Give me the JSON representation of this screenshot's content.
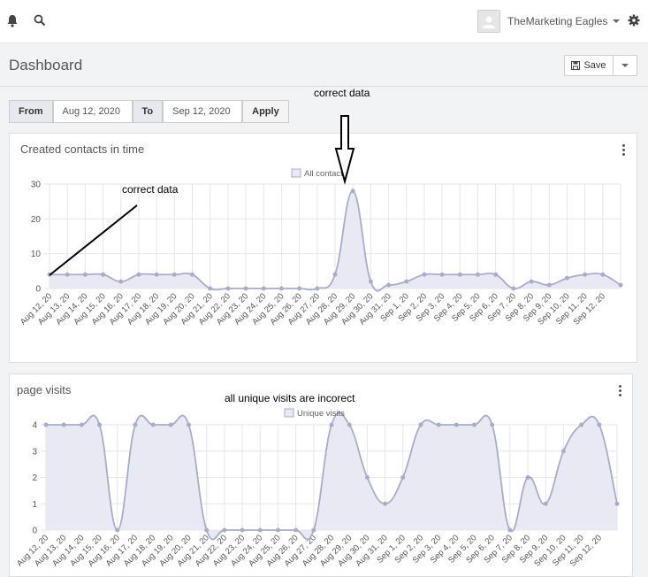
{
  "header": {
    "user_name": "TheMarketing Eagles",
    "icons": [
      "bell-icon",
      "search-icon",
      "user-avatar-icon",
      "chevron-down-icon",
      "gear-icon"
    ]
  },
  "page": {
    "title": "Dashboard",
    "save_label": "Save"
  },
  "filter": {
    "from_label": "From",
    "from_value": "Aug 12, 2020",
    "to_label": "To",
    "to_value": "Sep 12, 2020",
    "apply_label": "Apply"
  },
  "annotations": {
    "top": "correct data",
    "left": "correct data",
    "bottom": "all unique visits are incorect"
  },
  "colors": {
    "series_line": "#a9acc9",
    "series_fill": "#e8e9f3",
    "grid": "#e6e6e6",
    "annotation": "#000000"
  },
  "chart_data": [
    {
      "type": "area",
      "title": "Created contacts in time",
      "series": [
        {
          "name": "All contacts",
          "values": [
            4,
            4,
            4,
            4,
            2,
            4,
            4,
            4,
            4,
            0,
            0,
            0,
            0,
            0,
            0,
            0,
            4,
            28,
            2,
            1,
            2,
            4,
            4,
            4,
            4,
            4,
            0,
            2,
            1,
            3,
            4,
            4,
            1
          ]
        }
      ],
      "x": [
        "Aug 12, 20",
        "Aug 13, 20",
        "Aug 14, 20",
        "Aug 15, 20",
        "Aug 16, 20",
        "Aug 17, 20",
        "Aug 18, 20",
        "Aug 19, 20",
        "Aug 20, 20",
        "Aug 21, 20",
        "Aug 22, 20",
        "Aug 23, 20",
        "Aug 24, 20",
        "Aug 25, 20",
        "Aug 26, 20",
        "Aug 27, 20",
        "Aug 28, 20",
        "Aug 29, 20",
        "Aug 30, 20",
        "Aug 31, 20",
        "Sep 1, 20",
        "Sep 2, 20",
        "Sep 3, 20",
        "Sep 4, 20",
        "Sep 5, 20",
        "Sep 6, 20",
        "Sep 7, 20",
        "Sep 8, 20",
        "Sep 9, 20",
        "Sep 10, 20",
        "Sep 11, 20",
        "Sep 12, 20"
      ],
      "y_ticks": [
        0,
        10,
        20,
        30
      ],
      "ylim": [
        0,
        30
      ],
      "grid": true,
      "legend": "top"
    },
    {
      "type": "area",
      "title": "page visits",
      "series": [
        {
          "name": "Unique visits",
          "values": [
            4,
            4,
            4,
            4,
            0,
            4,
            4,
            4,
            4,
            0,
            0,
            0,
            0,
            0,
            0,
            0,
            4,
            4,
            2,
            1,
            2,
            4,
            4,
            4,
            4,
            4,
            0,
            2,
            1,
            3,
            4,
            4,
            1
          ]
        }
      ],
      "x": [
        "Aug 12, 20",
        "Aug 13, 20",
        "Aug 14, 20",
        "Aug 15, 20",
        "Aug 16, 20",
        "Aug 17, 20",
        "Aug 18, 20",
        "Aug 19, 20",
        "Aug 20, 20",
        "Aug 21, 20",
        "Aug 22, 20",
        "Aug 23, 20",
        "Aug 24, 20",
        "Aug 25, 20",
        "Aug 26, 20",
        "Aug 27, 20",
        "Aug 28, 20",
        "Aug 29, 20",
        "Aug 30, 20",
        "Aug 31, 20",
        "Sep 1, 20",
        "Sep 2, 20",
        "Sep 3, 20",
        "Sep 4, 20",
        "Sep 5, 20",
        "Sep 6, 20",
        "Sep 7, 20",
        "Sep 8, 20",
        "Sep 9, 20",
        "Sep 10, 20",
        "Sep 11, 20",
        "Sep 12, 20"
      ],
      "y_ticks": [
        0,
        1,
        2,
        3,
        4
      ],
      "ylim": [
        0,
        4
      ],
      "grid": true,
      "legend": "top"
    }
  ]
}
